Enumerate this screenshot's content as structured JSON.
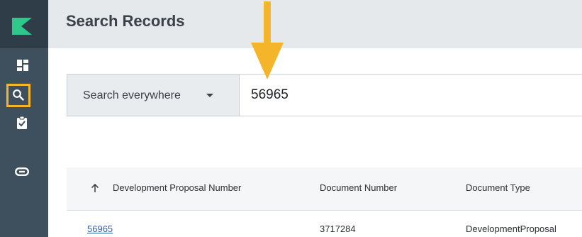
{
  "page": {
    "title": "Search Records"
  },
  "sidebar": {
    "items": [
      {
        "name": "dashboard",
        "icon": "dashboard-icon"
      },
      {
        "name": "search",
        "icon": "search-icon",
        "active": true
      },
      {
        "name": "tasks",
        "icon": "clipboard-check-icon"
      },
      {
        "name": "links",
        "icon": "link-icon"
      }
    ]
  },
  "search": {
    "scope_label": "Search everywhere",
    "value": "56965"
  },
  "results": {
    "columns": [
      "Development Proposal Number",
      "Document Number",
      "Document Type"
    ],
    "rows": [
      [
        "56965",
        "3717284",
        "DevelopmentProposal"
      ]
    ]
  },
  "colors": {
    "sidebar": "#3e4f5d",
    "logo": "#2ec88a",
    "accent_highlight": "#f5b52b",
    "link": "#2f5fa3"
  }
}
